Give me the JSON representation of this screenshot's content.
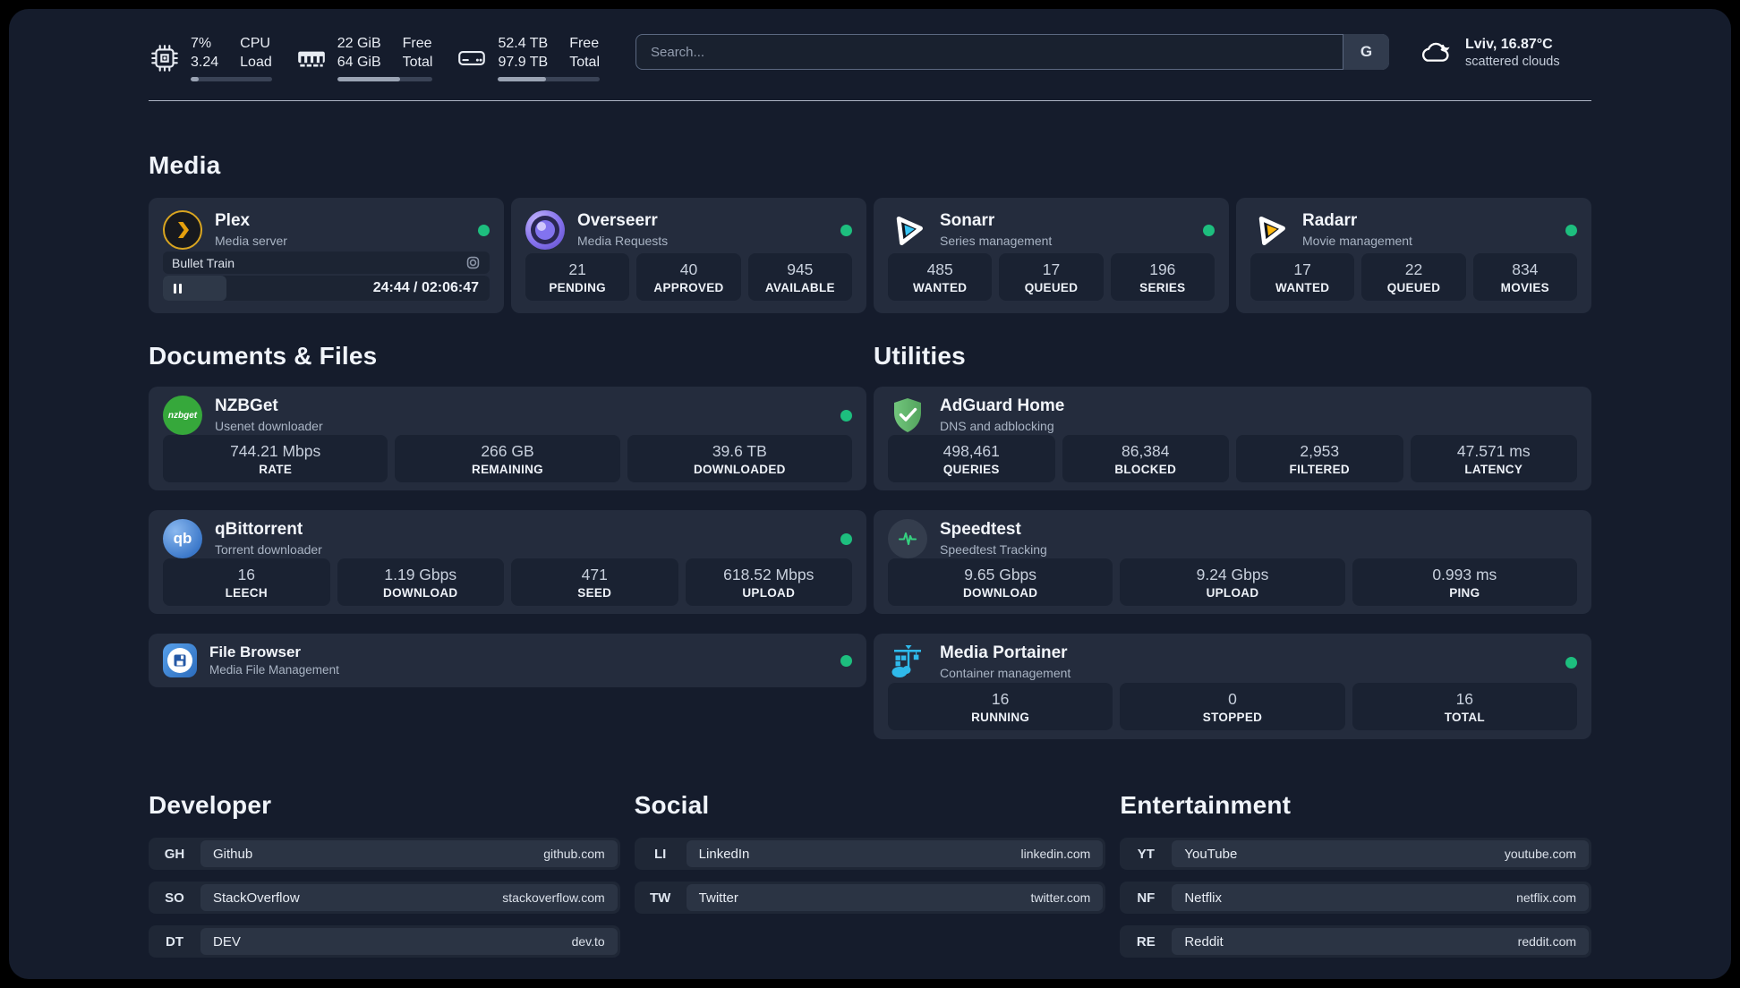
{
  "topbar": {
    "cpu": {
      "value_top": "7%",
      "value_bottom": "3.24",
      "label_top": "CPU",
      "label_bottom": "Load",
      "progress": 10
    },
    "ram": {
      "value_top": "22 GiB",
      "value_bottom": "64 GiB",
      "label_top": "Free",
      "label_bottom": "Total",
      "progress": 66
    },
    "disk": {
      "value_top": "52.4 TB",
      "value_bottom": "97.9 TB",
      "label_top": "Free",
      "label_bottom": "Total",
      "progress": 47
    },
    "search": {
      "placeholder": "Search...",
      "engine_button": "G"
    },
    "weather": {
      "location": "Lviv, 16.87°C",
      "condition": "scattered clouds"
    }
  },
  "media": {
    "title": "Media",
    "plex": {
      "name": "Plex",
      "description": "Media server",
      "player": {
        "title": "Bullet Train",
        "time_display": "24:44 / 02:06:47",
        "progress": 19.5
      }
    },
    "overseerr": {
      "name": "Overseerr",
      "description": "Media Requests",
      "stats": [
        {
          "value": "21",
          "label": "PENDING"
        },
        {
          "value": "40",
          "label": "APPROVED"
        },
        {
          "value": "945",
          "label": "AVAILABLE"
        }
      ]
    },
    "sonarr": {
      "name": "Sonarr",
      "description": "Series management",
      "stats": [
        {
          "value": "485",
          "label": "WANTED"
        },
        {
          "value": "17",
          "label": "QUEUED"
        },
        {
          "value": "196",
          "label": "SERIES"
        }
      ]
    },
    "radarr": {
      "name": "Radarr",
      "description": "Movie management",
      "stats": [
        {
          "value": "17",
          "label": "WANTED"
        },
        {
          "value": "22",
          "label": "QUEUED"
        },
        {
          "value": "834",
          "label": "MOVIES"
        }
      ]
    }
  },
  "documents": {
    "title": "Documents & Files",
    "nzbget": {
      "name": "NZBGet",
      "description": "Usenet downloader",
      "stats": [
        {
          "value": "744.21 Mbps",
          "label": "RATE"
        },
        {
          "value": "266 GB",
          "label": "REMAINING"
        },
        {
          "value": "39.6 TB",
          "label": "DOWNLOADED"
        }
      ]
    },
    "qbittorrent": {
      "name": "qBittorrent",
      "description": "Torrent downloader",
      "stats": [
        {
          "value": "16",
          "label": "LEECH"
        },
        {
          "value": "1.19 Gbps",
          "label": "DOWNLOAD"
        },
        {
          "value": "471",
          "label": "SEED"
        },
        {
          "value": "618.52 Mbps",
          "label": "UPLOAD"
        }
      ]
    },
    "filebrowser": {
      "name": "File Browser",
      "description": "Media File Management"
    }
  },
  "utilities": {
    "title": "Utilities",
    "adguard": {
      "name": "AdGuard Home",
      "description": "DNS and adblocking",
      "stats": [
        {
          "value": "498,461",
          "label": "QUERIES"
        },
        {
          "value": "86,384",
          "label": "BLOCKED"
        },
        {
          "value": "2,953",
          "label": "FILTERED"
        },
        {
          "value": "47.571 ms",
          "label": "LATENCY"
        }
      ]
    },
    "speedtest": {
      "name": "Speedtest",
      "description": "Speedtest Tracking",
      "stats": [
        {
          "value": "9.65 Gbps",
          "label": "DOWNLOAD"
        },
        {
          "value": "9.24 Gbps",
          "label": "UPLOAD"
        },
        {
          "value": "0.993 ms",
          "label": "PING"
        }
      ]
    },
    "portainer": {
      "name": "Media Portainer",
      "description": "Container management",
      "stats": [
        {
          "value": "16",
          "label": "RUNNING"
        },
        {
          "value": "0",
          "label": "STOPPED"
        },
        {
          "value": "16",
          "label": "TOTAL"
        }
      ]
    }
  },
  "bookmarks": {
    "developer": {
      "title": "Developer",
      "links": [
        {
          "abbr": "GH",
          "name": "Github",
          "url": "github.com"
        },
        {
          "abbr": "SO",
          "name": "StackOverflow",
          "url": "stackoverflow.com"
        },
        {
          "abbr": "DT",
          "name": "DEV",
          "url": "dev.to"
        }
      ]
    },
    "social": {
      "title": "Social",
      "links": [
        {
          "abbr": "LI",
          "name": "LinkedIn",
          "url": "linkedin.com"
        },
        {
          "abbr": "TW",
          "name": "Twitter",
          "url": "twitter.com"
        }
      ]
    },
    "entertainment": {
      "title": "Entertainment",
      "links": [
        {
          "abbr": "YT",
          "name": "YouTube",
          "url": "youtube.com"
        },
        {
          "abbr": "NF",
          "name": "Netflix",
          "url": "netflix.com"
        },
        {
          "abbr": "RE",
          "name": "Reddit",
          "url": "reddit.com"
        }
      ]
    }
  },
  "icons": {
    "nzbget_text": "nzbget",
    "qbittorrent_text": "qb"
  },
  "colors": {
    "status_online": "#1dbe7e",
    "panel_bg": "#151c2c",
    "card_bg": "#242c3d",
    "tile_bg": "#1a2232"
  }
}
